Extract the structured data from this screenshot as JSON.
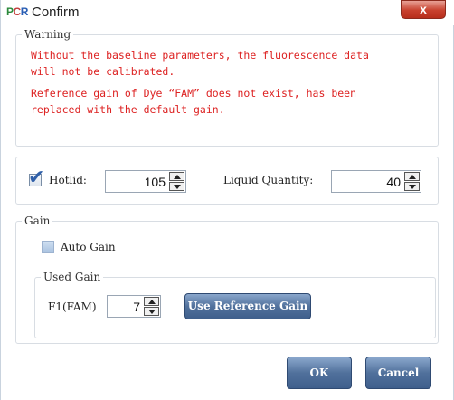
{
  "window": {
    "logo_part1": "P",
    "logo_part2": "C",
    "logo_part3": "R",
    "title": "Confirm",
    "close_label": "x"
  },
  "warning": {
    "group_title": "Warning",
    "line1": "Without the baseline parameters, the fluorescence data",
    "line2": "will not be calibrated.",
    "line3": "Reference gain of Dye “FAM” does not exist, has been",
    "line4": "replaced with the default gain.",
    "text_color": "#d22222"
  },
  "settings": {
    "hotlid_checked": true,
    "hotlid_label": "Hotlid:",
    "hotlid_value": "105",
    "liquid_label": "Liquid Quantity:",
    "liquid_value": "40"
  },
  "gain": {
    "group_title": "Gain",
    "auto_gain_label": "Auto Gain",
    "auto_gain_checked": false,
    "used_gain_title": "Used Gain",
    "channel_label": "F1(FAM)",
    "channel_value": "7",
    "use_reference_label": "Use Reference Gain"
  },
  "footer": {
    "ok_label": "OK",
    "cancel_label": "Cancel"
  },
  "colors": {
    "button_blue": "#51719c",
    "close_red": "#c8412e"
  }
}
